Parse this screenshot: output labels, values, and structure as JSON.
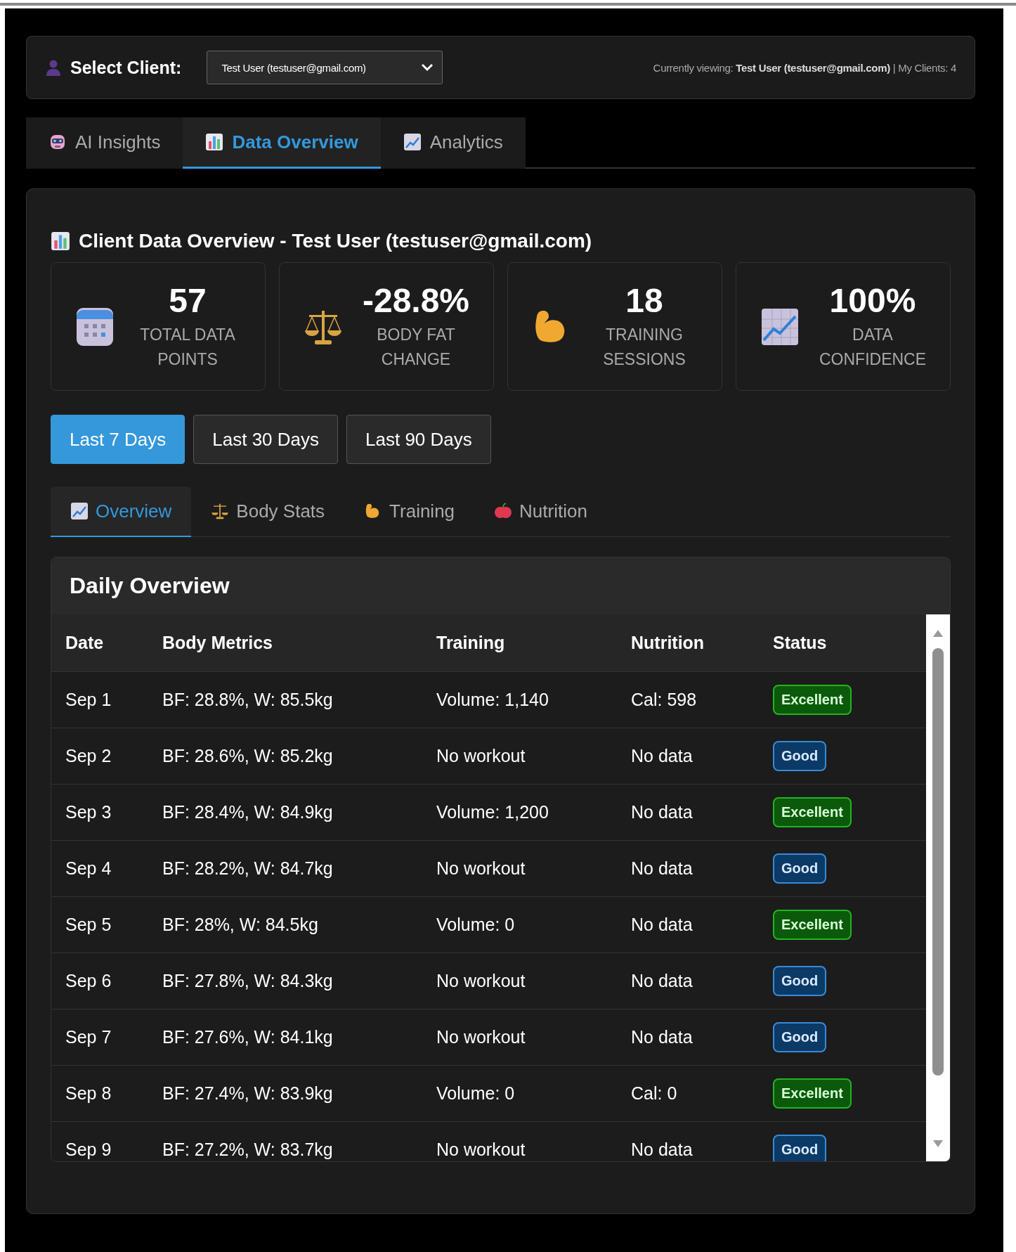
{
  "client_bar": {
    "label": "Select Client:",
    "select_value": "Test User (testuser@gmail.com)",
    "viewing": "Currently viewing: **Test User (testuser@gmail.com)** | My Clients: 4"
  },
  "tabs": [
    {
      "label": "AI Insights",
      "kind": "robot",
      "selected": false
    },
    {
      "label": "Data Overview",
      "kind": "bars",
      "selected": true
    },
    {
      "label": "Analytics",
      "kind": "chart",
      "selected": false
    }
  ],
  "title": "Client Data Overview - Test User (testuser@gmail.com)",
  "stats": [
    {
      "value": "57",
      "label": "TOTAL DATA POINTS",
      "kind": "calendar"
    },
    {
      "value": "-28.8%",
      "label": "BODY FAT CHANGE",
      "kind": "scale"
    },
    {
      "value": "18",
      "label": "TRAINING SESSIONS",
      "kind": "muscle"
    },
    {
      "value": "100%",
      "label": "DATA CONFIDENCE",
      "kind": "chart"
    }
  ],
  "ranges": [
    {
      "label": "Last 7 Days",
      "selected": true
    },
    {
      "label": "Last 30 Days",
      "selected": false
    },
    {
      "label": "Last 90 Days",
      "selected": false
    }
  ],
  "subtabs": [
    {
      "label": "Overview",
      "kind": "chart",
      "selected": true
    },
    {
      "label": "Body Stats",
      "kind": "scale",
      "selected": false
    },
    {
      "label": "Training",
      "kind": "muscle",
      "selected": false
    },
    {
      "label": "Nutrition",
      "kind": "apple",
      "selected": false
    }
  ],
  "table": {
    "title": "Daily Overview",
    "columns": [
      "Date",
      "Body Metrics",
      "Training",
      "Nutrition",
      "Status"
    ],
    "rows": [
      {
        "date": "Sep 1",
        "body": "BF: 28.8%, W: 85.5kg",
        "training": "Volume: 1,140",
        "nutrition": "Cal: 598",
        "status": "Excellent",
        "kind": "excellent"
      },
      {
        "date": "Sep 2",
        "body": "BF: 28.6%, W: 85.2kg",
        "training": "No workout",
        "nutrition": "No data",
        "status": "Good",
        "kind": "good"
      },
      {
        "date": "Sep 3",
        "body": "BF: 28.4%, W: 84.9kg",
        "training": "Volume: 1,200",
        "nutrition": "No data",
        "status": "Excellent",
        "kind": "excellent"
      },
      {
        "date": "Sep 4",
        "body": "BF: 28.2%, W: 84.7kg",
        "training": "No workout",
        "nutrition": "No data",
        "status": "Good",
        "kind": "good"
      },
      {
        "date": "Sep 5",
        "body": "BF: 28%, W: 84.5kg",
        "training": "Volume: 0",
        "nutrition": "No data",
        "status": "Excellent",
        "kind": "excellent"
      },
      {
        "date": "Sep 6",
        "body": "BF: 27.8%, W: 84.3kg",
        "training": "No workout",
        "nutrition": "No data",
        "status": "Good",
        "kind": "good"
      },
      {
        "date": "Sep 7",
        "body": "BF: 27.6%, W: 84.1kg",
        "training": "No workout",
        "nutrition": "No data",
        "status": "Good",
        "kind": "good"
      },
      {
        "date": "Sep 8",
        "body": "BF: 27.4%, W: 83.9kg",
        "training": "Volume: 0",
        "nutrition": "Cal: 0",
        "status": "Excellent",
        "kind": "excellent"
      },
      {
        "date": "Sep 9",
        "body": "BF: 27.2%, W: 83.7kg",
        "training": "No workout",
        "nutrition": "No data",
        "status": "Good",
        "kind": "good"
      }
    ]
  }
}
